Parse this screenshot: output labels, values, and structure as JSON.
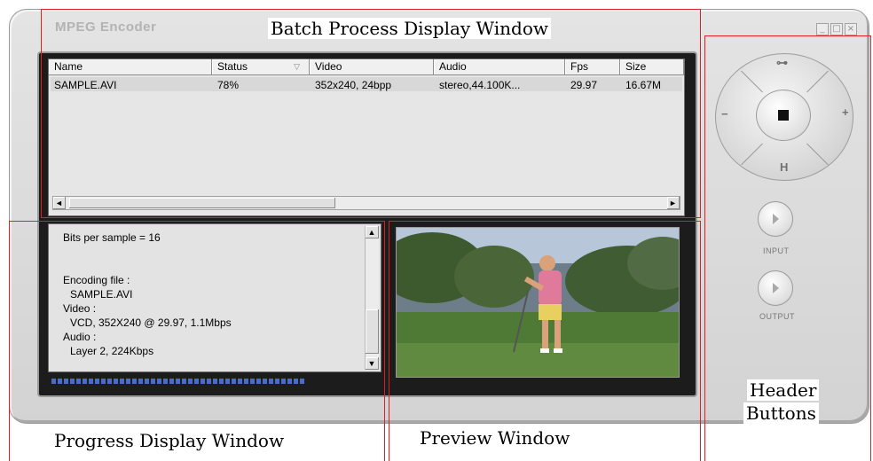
{
  "window": {
    "title": "MPEG Encoder",
    "controls": [
      "_",
      "□",
      "×"
    ]
  },
  "list": {
    "columns": [
      "Name",
      "Status",
      "Video",
      "Audio",
      "Fps",
      "Size"
    ],
    "rows": [
      {
        "name": "SAMPLE.AVI",
        "status": "78%",
        "video": "352x240, 24bpp",
        "audio": "stereo,44.100K...",
        "fps": "29.97",
        "size": "16.67M"
      }
    ],
    "scroll_left": "◄",
    "scroll_right": "►"
  },
  "log": {
    "lines": [
      "Bits per sample = 16",
      "Encoding file :",
      "SAMPLE.AVI",
      "Video :",
      "VCD, 352X240 @ 29.97, 1.1Mbps",
      "Audio :",
      "Layer 2, 224Kbps"
    ],
    "scroll_up": "▲",
    "scroll_down": "▼"
  },
  "progress": {
    "fraction": 0.78
  },
  "controls": {
    "top_label": "⊶",
    "left_label": "−",
    "right_label": "+",
    "bottom_label": "H",
    "input_label": "INPUT",
    "output_label": "OUTPUT"
  },
  "annotations": {
    "batch": "Batch Process Display Window",
    "progress": "Progress Display Window",
    "preview": "Preview Window",
    "header_line1": "Header",
    "header_line2": "Buttons",
    "border_color": "#e02020"
  }
}
